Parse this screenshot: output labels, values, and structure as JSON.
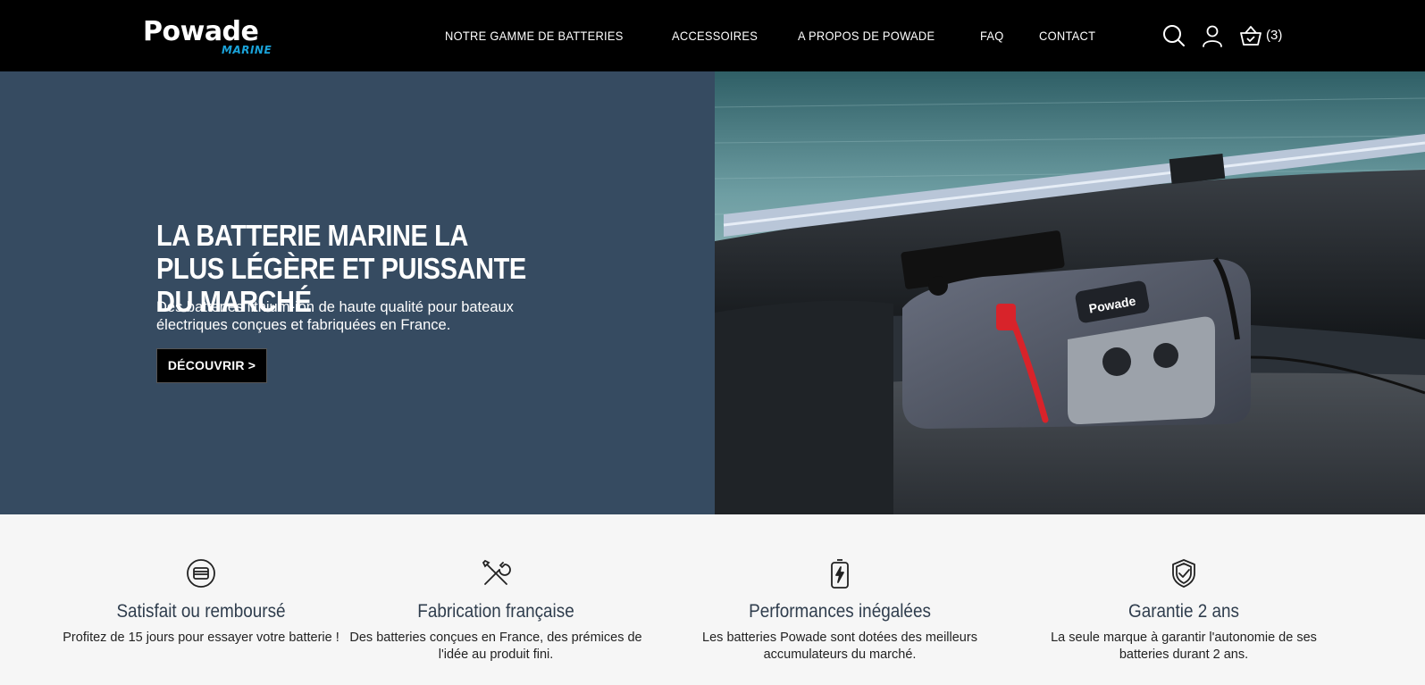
{
  "brand": {
    "name": "Powade",
    "sub": "MARINE",
    "accent": "#1aa3d9"
  },
  "nav": {
    "items": [
      {
        "label": "NOTRE GAMME DE BATTERIES"
      },
      {
        "label": "ACCESSOIRES"
      },
      {
        "label": "A PROPOS DE POWADE"
      },
      {
        "label": "FAQ"
      },
      {
        "label": "CONTACT"
      }
    ]
  },
  "header_icons": {
    "search": "search-icon",
    "account": "user-icon",
    "cart": "basket-icon",
    "cart_count": "(3)"
  },
  "hero": {
    "title": "LA BATTERIE MARINE LA PLUS LÉGÈRE ET PUISSANTE DU MARCHÉ",
    "subtitle": "Des batteries lithium-ion de haute qualité pour bateaux électriques conçues et fabriquées en France.",
    "cta": "DÉCOUVRIR >",
    "product_label": "Powade",
    "background": "#364b61"
  },
  "features": [
    {
      "icon": "card-refund-icon",
      "title": "Satisfait ou remboursé",
      "desc": "Profitez de 15 jours pour essayer votre batterie !"
    },
    {
      "icon": "tools-icon",
      "title": "Fabrication française",
      "desc": "Des batteries conçues en France, des prémices de l'idée au produit fini."
    },
    {
      "icon": "battery-charge-icon",
      "title": "Performances inégalées",
      "desc": "Les batteries Powade sont dotées des meilleurs accumulateurs du marché."
    },
    {
      "icon": "shield-check-icon",
      "title": "Garantie 2 ans",
      "desc": "La seule marque à garantir l'autonomie de ses batteries durant 2 ans."
    }
  ]
}
